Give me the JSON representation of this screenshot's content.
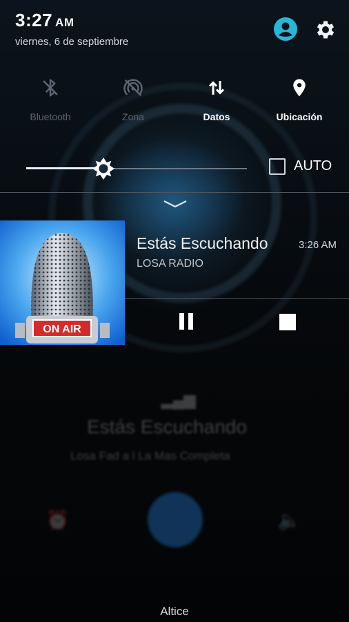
{
  "status_bar": {
    "time": "3:27",
    "ampm": "AM",
    "date": "viernes, 6 de septiembre",
    "icons": [
      "user-icon",
      "gear-icon"
    ]
  },
  "quick_settings": {
    "tiles": [
      {
        "label": "Bluetooth",
        "icon": "bluetooth-icon",
        "active": false
      },
      {
        "label": "Zona",
        "icon": "hotspot-icon",
        "active": false
      },
      {
        "label": "Datos",
        "icon": "data-transfer-icon",
        "active": true
      },
      {
        "label": "Ubicación",
        "icon": "location-pin-icon",
        "active": true
      }
    ],
    "brightness_level": 0.35,
    "auto_label": "AUTO",
    "auto_checked": false
  },
  "notification": {
    "title": "Estás Escuchando",
    "time": "3:26 AM",
    "subtitle": "LOSA RADIO",
    "artwork_text": "ON AIR",
    "controls": [
      "pause-icon",
      "stop-icon"
    ]
  },
  "background_app": {
    "title": "Estás Escuchando",
    "subtitle": "Losa Fad a l La Mas Completa"
  },
  "carrier": "Altice",
  "colors": {
    "accent": "#29b6d8",
    "on_air_red": "#d42a2a",
    "art_blue": "#1e7fe0"
  }
}
